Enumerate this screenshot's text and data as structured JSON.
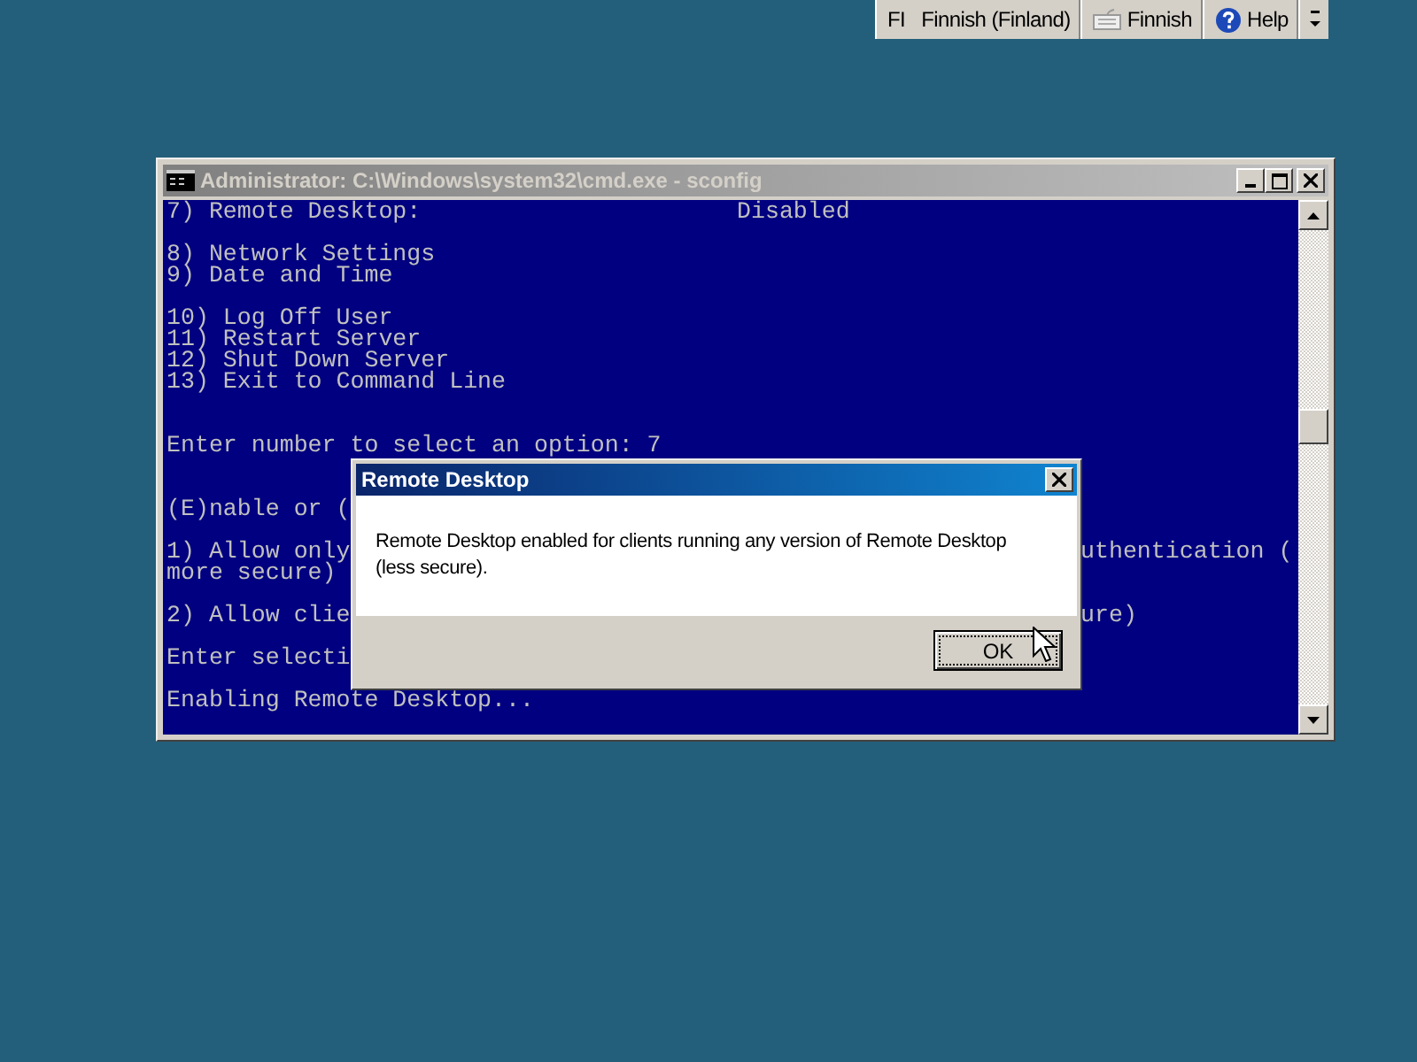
{
  "language_bar": {
    "language_code": "FI",
    "language": "Finnish (Finland)",
    "keyboard": "Finnish",
    "help": "Help"
  },
  "window": {
    "title": "Administrator: C:\\Windows\\system32\\cmd.exe - sconfig",
    "active": false
  },
  "console": {
    "groups": [
      {
        "extra_space": false,
        "lines": [
          {
            "kind": "setting",
            "text": "7) Remote Desktop:",
            "value": "Disabled"
          }
        ]
      },
      {
        "extra_space": false,
        "lines": [
          {
            "kind": "text",
            "text": "8) Network Settings"
          },
          {
            "kind": "text",
            "text": "9) Date and Time"
          }
        ]
      },
      {
        "extra_space": true,
        "lines": [
          {
            "kind": "text",
            "text": "10) Log Off User"
          },
          {
            "kind": "text",
            "text": "11) Restart Server"
          },
          {
            "kind": "text",
            "text": "12) Shut Down Server"
          },
          {
            "kind": "text",
            "text": "13) Exit to Command Line"
          }
        ]
      },
      {
        "extra_space": true,
        "lines": [
          {
            "kind": "text",
            "text": "Enter number to select an option: 7"
          }
        ]
      },
      {
        "extra_space": false,
        "lines": [
          {
            "kind": "text",
            "text": "(E)nable or ("
          }
        ]
      },
      {
        "extra_space": false,
        "lines": [
          {
            "kind": "split",
            "text": "1) Allow only",
            "right": "uthentication ("
          },
          {
            "kind": "text",
            "text": "more secure)"
          }
        ]
      },
      {
        "extra_space": false,
        "lines": [
          {
            "kind": "split",
            "text": "2) Allow clie",
            "right": "ure)"
          }
        ]
      },
      {
        "extra_space": false,
        "lines": [
          {
            "kind": "text",
            "text": "Enter selecti"
          }
        ]
      },
      {
        "extra_space": false,
        "lines": [
          {
            "kind": "text",
            "text": "Enabling Remote Desktop..."
          }
        ]
      }
    ]
  },
  "dialog": {
    "title": "Remote Desktop",
    "message": "Remote Desktop enabled for clients running any version of Remote Desktop (less secure).",
    "buttons": [
      "OK"
    ]
  }
}
